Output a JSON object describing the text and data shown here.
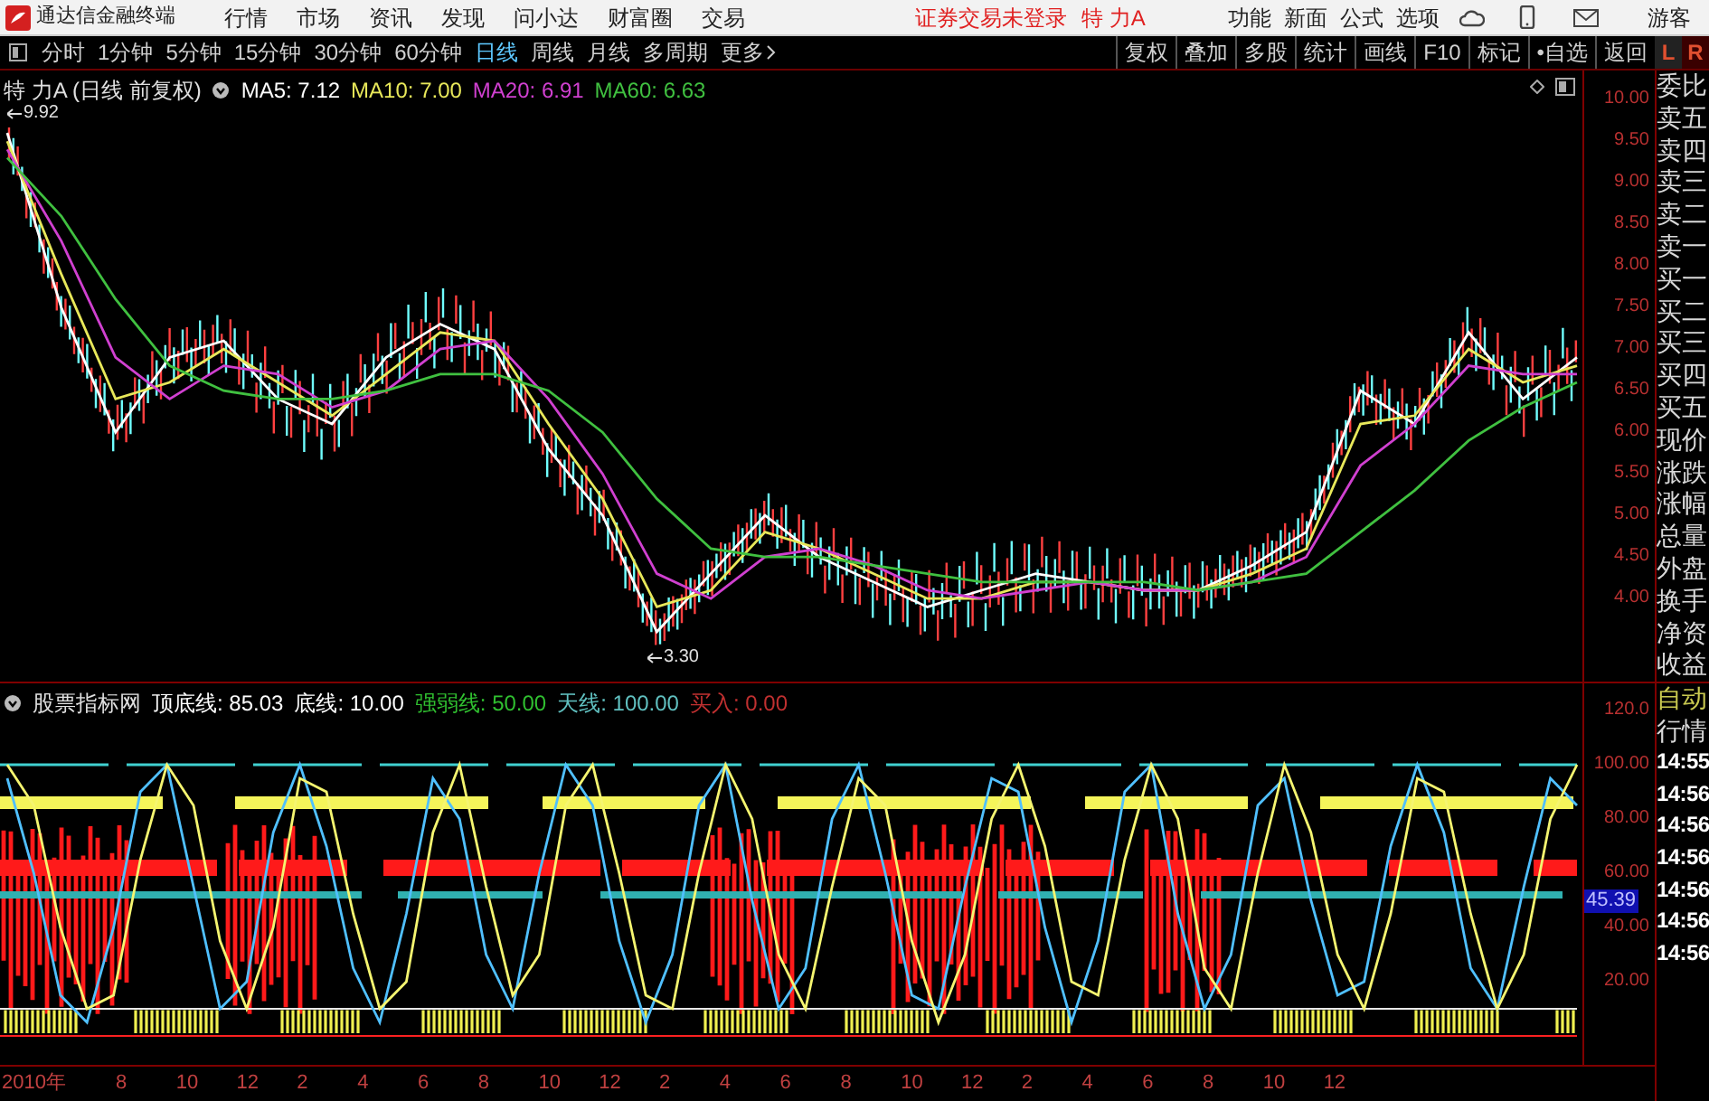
{
  "menu_bar": {
    "app_title": "通达信金融终端",
    "menus": [
      "行情",
      "市场",
      "资讯",
      "发现",
      "问小达",
      "财富圈",
      "交易"
    ],
    "login_status": "证券交易未登录",
    "stock_name": "特 力A",
    "right_menus": [
      "功能",
      "新面",
      "公式",
      "选项"
    ],
    "user": "游客"
  },
  "toolbar": {
    "periods": [
      {
        "label": "分时",
        "selected": false
      },
      {
        "label": "1分钟",
        "selected": false
      },
      {
        "label": "5分钟",
        "selected": false
      },
      {
        "label": "15分钟",
        "selected": false
      },
      {
        "label": "30分钟",
        "selected": false
      },
      {
        "label": "60分钟",
        "selected": false
      },
      {
        "label": "日线",
        "selected": true
      },
      {
        "label": "周线",
        "selected": false
      },
      {
        "label": "月线",
        "selected": false
      },
      {
        "label": "多周期",
        "selected": false
      }
    ],
    "more": "更多",
    "tools": [
      "复权",
      "叠加",
      "多股",
      "统计",
      "画线",
      "F10",
      "标记",
      "•自选",
      "返回"
    ],
    "corner": [
      "L",
      "R"
    ]
  },
  "main_chart": {
    "title": "特 力A (日线 前复权)",
    "high_label": "9.92",
    "low_label": "3.30",
    "chart_data": {
      "type": "line",
      "ylim": [
        2.98,
        10.35
      ],
      "yticks": [
        {
          "value": 10,
          "label": "10.00"
        },
        {
          "value": 9.5,
          "label": "9.50"
        },
        {
          "value": 9,
          "label": "9.00"
        },
        {
          "value": 8.5,
          "label": "8.50"
        },
        {
          "value": 8,
          "label": "8.00"
        },
        {
          "value": 7.5,
          "label": "7.50"
        },
        {
          "value": 7,
          "label": "7.00"
        },
        {
          "value": 6.5,
          "label": "6.50"
        },
        {
          "value": 6,
          "label": "6.00"
        },
        {
          "value": 5.5,
          "label": "5.50"
        },
        {
          "value": 5,
          "label": "5.00"
        },
        {
          "value": 4.5,
          "label": "4.50"
        },
        {
          "value": 4,
          "label": "4.00"
        }
      ],
      "series": [
        {
          "name": "MA5: 7.12",
          "color": "#ffffff",
          "values": [
            9.6,
            7.5,
            6.0,
            6.9,
            7.1,
            6.4,
            6.1,
            6.9,
            7.3,
            7.0,
            5.8,
            5.0,
            3.6,
            4.3,
            5.0,
            4.5,
            4.2,
            3.9,
            4.1,
            4.3,
            4.2,
            4.1,
            4.1,
            4.4,
            4.8,
            6.5,
            6.1,
            7.2,
            6.4,
            6.9
          ]
        },
        {
          "name": "MA10: 7.00",
          "color": "#e8e85a",
          "values": [
            9.5,
            7.9,
            6.4,
            6.6,
            7.0,
            6.6,
            6.2,
            6.7,
            7.2,
            7.1,
            6.1,
            5.2,
            3.9,
            4.1,
            4.8,
            4.6,
            4.3,
            4.0,
            4.0,
            4.2,
            4.2,
            4.1,
            4.1,
            4.3,
            4.6,
            6.1,
            6.2,
            7.0,
            6.6,
            6.8
          ]
        },
        {
          "name": "MA20: 6.91",
          "color": "#d040d0",
          "values": [
            9.4,
            8.3,
            6.9,
            6.4,
            6.8,
            6.7,
            6.3,
            6.5,
            7.0,
            7.1,
            6.4,
            5.5,
            4.3,
            4.0,
            4.5,
            4.6,
            4.4,
            4.1,
            4.0,
            4.1,
            4.2,
            4.1,
            4.1,
            4.2,
            4.5,
            5.6,
            6.1,
            6.8,
            6.7,
            6.7
          ]
        },
        {
          "name": "MA60: 6.63",
          "color": "#40c040",
          "values": [
            9.3,
            8.6,
            7.6,
            6.8,
            6.5,
            6.4,
            6.4,
            6.5,
            6.7,
            6.7,
            6.5,
            6.0,
            5.2,
            4.6,
            4.5,
            4.5,
            4.4,
            4.3,
            4.2,
            4.2,
            4.2,
            4.2,
            4.1,
            4.2,
            4.3,
            4.8,
            5.3,
            5.9,
            6.3,
            6.6
          ]
        }
      ]
    }
  },
  "indicator": {
    "name": "股票指标网",
    "lines": [
      {
        "label": "顶底线: 85.03",
        "color": "#ffffff"
      },
      {
        "label": "底线: 10.00",
        "color": "#ffffff"
      },
      {
        "label": "强弱线: 50.00",
        "color": "#30c030"
      },
      {
        "label": "天线: 100.00",
        "color": "#60c0c0"
      },
      {
        "label": "买入: 0.00",
        "color": "#c03030"
      }
    ],
    "current_value": "45.39",
    "chart_data": {
      "type": "line",
      "ylim": [
        -10,
        130
      ],
      "yticks": [
        {
          "value": 120,
          "label": "120.0"
        },
        {
          "value": 100,
          "label": "100.00"
        },
        {
          "value": 80,
          "label": "80.00"
        },
        {
          "value": 60,
          "label": "60.00"
        },
        {
          "value": 40,
          "label": "40.00"
        },
        {
          "value": 20,
          "label": "20.00"
        }
      ],
      "series": [
        {
          "color": "#50c0ff",
          "values": [
            95,
            60,
            15,
            5,
            40,
            90,
            100,
            55,
            10,
            20,
            75,
            100,
            70,
            25,
            5,
            45,
            95,
            80,
            30,
            10,
            60,
            100,
            85,
            35,
            5,
            30,
            85,
            100,
            50,
            10,
            25,
            80,
            100,
            60,
            15,
            10,
            55,
            95,
            90,
            40,
            5,
            35,
            90,
            100,
            45,
            10,
            30,
            85,
            95,
            50,
            15,
            20,
            70,
            100,
            75,
            25,
            10,
            55,
            95,
            85
          ]
        },
        {
          "color": "#f5f570",
          "values": [
            100,
            85,
            40,
            10,
            15,
            65,
            100,
            85,
            35,
            10,
            40,
            95,
            90,
            45,
            10,
            20,
            75,
            100,
            55,
            15,
            30,
            85,
            100,
            60,
            15,
            10,
            60,
            100,
            80,
            30,
            10,
            55,
            95,
            85,
            35,
            5,
            30,
            80,
            100,
            70,
            20,
            15,
            65,
            100,
            80,
            25,
            10,
            60,
            100,
            75,
            30,
            10,
            45,
            95,
            90,
            45,
            10,
            30,
            80,
            100
          ]
        }
      ]
    }
  },
  "date_axis": [
    "2010年",
    "8",
    "10",
    "12",
    "2",
    "4",
    "6",
    "8",
    "10",
    "12",
    "2",
    "4",
    "6",
    "8",
    "10",
    "12",
    "2",
    "4",
    "6",
    "8",
    "10",
    "12"
  ],
  "quote_panel": {
    "labels": [
      "委比",
      "卖五",
      "卖四",
      "卖三",
      "卖二",
      "卖一",
      "买一",
      "买二",
      "买三",
      "买四",
      "买五",
      "现价",
      "涨跌",
      "涨幅",
      "总量",
      "外盘",
      "换手",
      "净资",
      "收益"
    ],
    "modes": [
      "自动",
      "行情"
    ],
    "times": [
      "14:55",
      "14:56",
      "14:56",
      "14:56",
      "14:56",
      "14:56",
      "14:56"
    ]
  }
}
